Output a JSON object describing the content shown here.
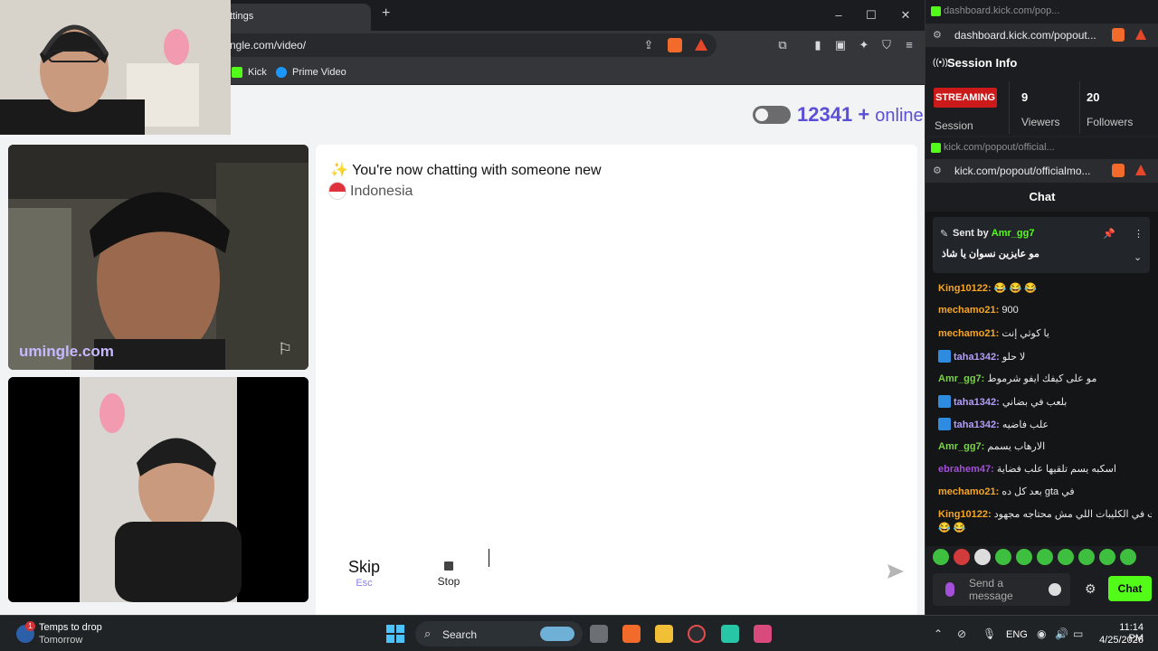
{
  "browser": {
    "tab_title": "ttings",
    "new_tab": "+",
    "window_controls": [
      "–",
      "☐",
      "✕"
    ],
    "url": "ngle.com/video/",
    "bookmarks": [
      {
        "label": "Kick",
        "color": "#53fc18"
      },
      {
        "label": "Prime Video",
        "color": "#1a98ff"
      }
    ]
  },
  "page": {
    "online_count": "12341",
    "online_suffix": "+",
    "online_label": "online",
    "toggle_state": "off",
    "chat_header": "You're now chatting with someone new",
    "chat_header_icon": "sparkles-icon",
    "country": "Indonesia",
    "watermark": "umingle.com",
    "skip_label": "Skip",
    "skip_hint": "Esc",
    "stop_label": "Stop",
    "message_input_value": "",
    "accent_color": "#5b4fd7"
  },
  "dashboard_popout": {
    "title": "dashboard.kick.com/pop...",
    "url": "dashboard.kick.com/popout...",
    "section_title": "Session Info",
    "status_badge": "STREAMING",
    "session_label": "Session",
    "viewers_value": "9",
    "viewers_label": "Viewers",
    "followers_value": "20",
    "followers_label": "Followers"
  },
  "chat_popout": {
    "title": "kick.com/popout/official...",
    "url": "kick.com/popout/officialmo...",
    "heading": "Chat",
    "pinned": {
      "prefix": "Sent by",
      "sender": "Amr_gg7",
      "text": "مو عايزين نسوان يا شاذ"
    },
    "messages": [
      {
        "user": "King10122:",
        "text": "😂 😂 😂",
        "color": "#f5a623",
        "badge": false
      },
      {
        "user": "mechamo21:",
        "text": "900",
        "color": "#f5a623",
        "badge": false
      },
      {
        "user": "mechamo21:",
        "text": "يا كوثي إنت",
        "color": "#f5a623",
        "badge": false
      },
      {
        "user": "taha1342:",
        "text": "لا حلو",
        "color": "#b39dfc",
        "badge": true
      },
      {
        "user": "Amr_gg7:",
        "text": "مو على كيفك ايفو شرموط",
        "color": "#7bd148",
        "badge": false
      },
      {
        "user": "taha1342:",
        "text": "بلعب في بضاني",
        "color": "#b39dfc",
        "badge": true
      },
      {
        "user": "taha1342:",
        "text": "علب فاضيه",
        "color": "#b39dfc",
        "badge": true
      },
      {
        "user": "Amr_gg7:",
        "text": "الارهاب يسمم",
        "color": "#7bd148",
        "badge": false
      },
      {
        "user": "ebrahem47:",
        "text": "اسكبه يسم تلقيها علب فضاية",
        "color": "#a44fd8",
        "badge": false
      },
      {
        "user": "mechamo21:",
        "text": "بعد كل ده gta في",
        "color": "#f5a623",
        "badge": false
      },
      {
        "user": "King10122:",
        "text": "اموت في الكليبات اللي مش محتاجه مجهود",
        "color": "#f5a623",
        "badge": false
      }
    ],
    "last_line": "😂 😂",
    "send_placeholder": "Send a message",
    "chat_button": "Chat",
    "brand_color": "#53fc18"
  },
  "taskbar": {
    "weather_line1": "Temps to drop",
    "weather_line2": "Tomorrow",
    "weather_badge": "1",
    "search_label": "Search",
    "language": "ENG",
    "time": "11:14 PM",
    "date": "4/25/2026"
  }
}
